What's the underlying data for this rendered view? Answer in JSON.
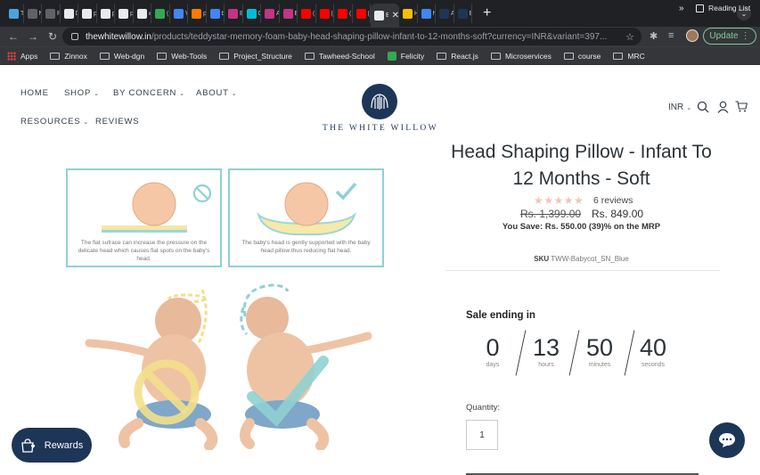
{
  "browser": {
    "tabs": [
      {
        "label": "T",
        "color": "#4aa3df"
      },
      {
        "label": "N",
        "color": "#5f6368"
      },
      {
        "label": "P",
        "color": "#5f6368"
      },
      {
        "label": "D",
        "color": "#e8eaed"
      },
      {
        "label": "p",
        "color": "#e8eaed"
      },
      {
        "label": "p",
        "color": "#e8eaed"
      },
      {
        "label": "p",
        "color": "#e8eaed"
      },
      {
        "label": "w",
        "color": "#e8eaed"
      },
      {
        "label": "(",
        "color": "#34a853"
      },
      {
        "label": "Y",
        "color": "#4285f4"
      },
      {
        "label": "p",
        "color": "#ff7a00"
      },
      {
        "label": "b",
        "color": "#4285f4"
      },
      {
        "label": "E",
        "color": "#c13584"
      },
      {
        "label": "C",
        "color": "#00bcd4"
      },
      {
        "label": "A",
        "color": "#c13584"
      },
      {
        "label": "E",
        "color": "#c13584"
      },
      {
        "label": "(",
        "color": "#ff0000"
      },
      {
        "label": "(",
        "color": "#ff0000"
      },
      {
        "label": "(",
        "color": "#ff0000"
      },
      {
        "label": "(",
        "color": "#ff0000"
      }
    ],
    "active_tab": {
      "label": "Ba",
      "color": "#e8eaed"
    },
    "tabs_after": [
      {
        "label": "H",
        "color": "#fbbc04"
      },
      {
        "label": "h",
        "color": "#4285f4"
      },
      {
        "label": "A",
        "color": "#1d3557"
      },
      {
        "label": "E",
        "color": "#1d3557"
      }
    ],
    "url_host": "thewhitewillow.in",
    "url_path": "/products/teddystar-memory-foam-baby-head-shaping-pillow-infant-to-12-months-soft?currency=INR&variant=397...",
    "update_label": "Update",
    "bookmarks": [
      {
        "label": "Apps",
        "icon": "apps-icon"
      },
      {
        "label": "Zinnox",
        "icon": "folder-icon"
      },
      {
        "label": "Web-dgn",
        "icon": "folder-icon"
      },
      {
        "label": "Web-Tools",
        "icon": "folder-icon"
      },
      {
        "label": "Project_Structure",
        "icon": "folder-icon"
      },
      {
        "label": "Tawheed-School",
        "icon": "folder-icon"
      },
      {
        "label": "Felicity",
        "icon": "felicity-icon"
      },
      {
        "label": "React.js",
        "icon": "folder-icon"
      },
      {
        "label": "Microservices",
        "icon": "folder-icon"
      },
      {
        "label": "course",
        "icon": "folder-icon"
      },
      {
        "label": "MRC",
        "icon": "folder-icon"
      }
    ],
    "bookmarks_more": "»",
    "reading_list": "Reading List"
  },
  "nav": {
    "home": "HOME",
    "shop": "SHOP",
    "by_concern": "BY CONCERN",
    "about": "ABOUT",
    "resources": "RESOURCES",
    "reviews": "REVIEWS"
  },
  "brand": {
    "name": "THE WHITE WILLOW",
    "color": "#1d3557"
  },
  "currency": "INR",
  "images": {
    "panel_left_caption": "The flat sufrace can increase the pressure on the delicate head which causes flat spots on the baby's head.",
    "panel_right_caption": "The baby's head is gently supported with the baby head pillow thus reducing flat head."
  },
  "product": {
    "title_line1": "Head Shaping Pillow - Infant To",
    "title_line2": "12 Months - Soft",
    "stars": "★★★★★",
    "reviews": "6 reviews",
    "price_old": "Rs. 1,399.00",
    "price_new": "Rs. 849.00",
    "savings": "You Save: Rs. 550.00 (39)% on the MRP",
    "sku_label": "SKU",
    "sku_value": "TWW-Babycot_SN_Blue"
  },
  "countdown": {
    "heading": "Sale ending in",
    "days": "0",
    "days_label": "days",
    "hours": "13",
    "hours_label": "hours",
    "minutes": "50",
    "minutes_label": "minutes",
    "seconds": "40",
    "seconds_label": "seconds"
  },
  "quantity": {
    "label": "Quantity:",
    "value": "1"
  },
  "rewards_label": "Rewards"
}
